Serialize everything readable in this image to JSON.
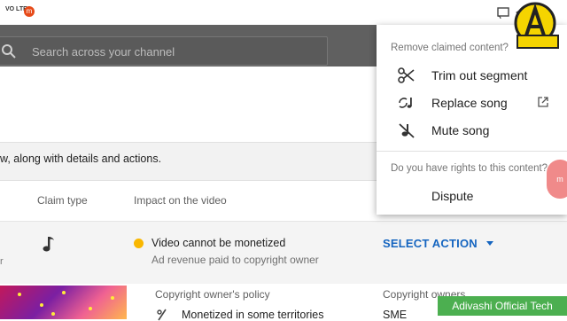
{
  "statusbar": {
    "left_text": "VO LTE8",
    "rec_glyph": "m"
  },
  "search": {
    "placeholder": "Search across your channel",
    "icon": "search-icon"
  },
  "banner": {
    "text": "w, along with details and actions."
  },
  "table": {
    "columns": [
      "Claim type",
      "Impact on the video"
    ],
    "row": {
      "left_fragment": "r",
      "claim_icon": "music-note-icon",
      "impact_main": "Video cannot be monetized",
      "impact_sub": "Ad revenue paid to copyright owner",
      "impact_status_color": "#f9b700",
      "action_label": "SELECT ACTION"
    },
    "details": {
      "policy_label": "Copyright owner's policy",
      "policy_value": "Monetized in some territories",
      "owner_label": "Copyright owners",
      "owner_value": "SME"
    }
  },
  "menu": {
    "header1": "Remove claimed content?",
    "items": [
      {
        "label": "Trim out segment",
        "icon": "scissors-icon"
      },
      {
        "label": "Replace song",
        "icon": "replace-song-icon",
        "trailing_icon": "external-link-icon"
      },
      {
        "label": "Mute song",
        "icon": "mute-music-icon"
      }
    ],
    "header2": "Do you have rights to this content?",
    "dispute_label": "Dispute"
  },
  "watermark": {
    "text": "Adivashi Official Tech"
  },
  "bubble": {
    "text": "m"
  },
  "colors": {
    "accent": "#1565c0",
    "topbar": "#606060",
    "watermark_bg": "#4caf50"
  }
}
